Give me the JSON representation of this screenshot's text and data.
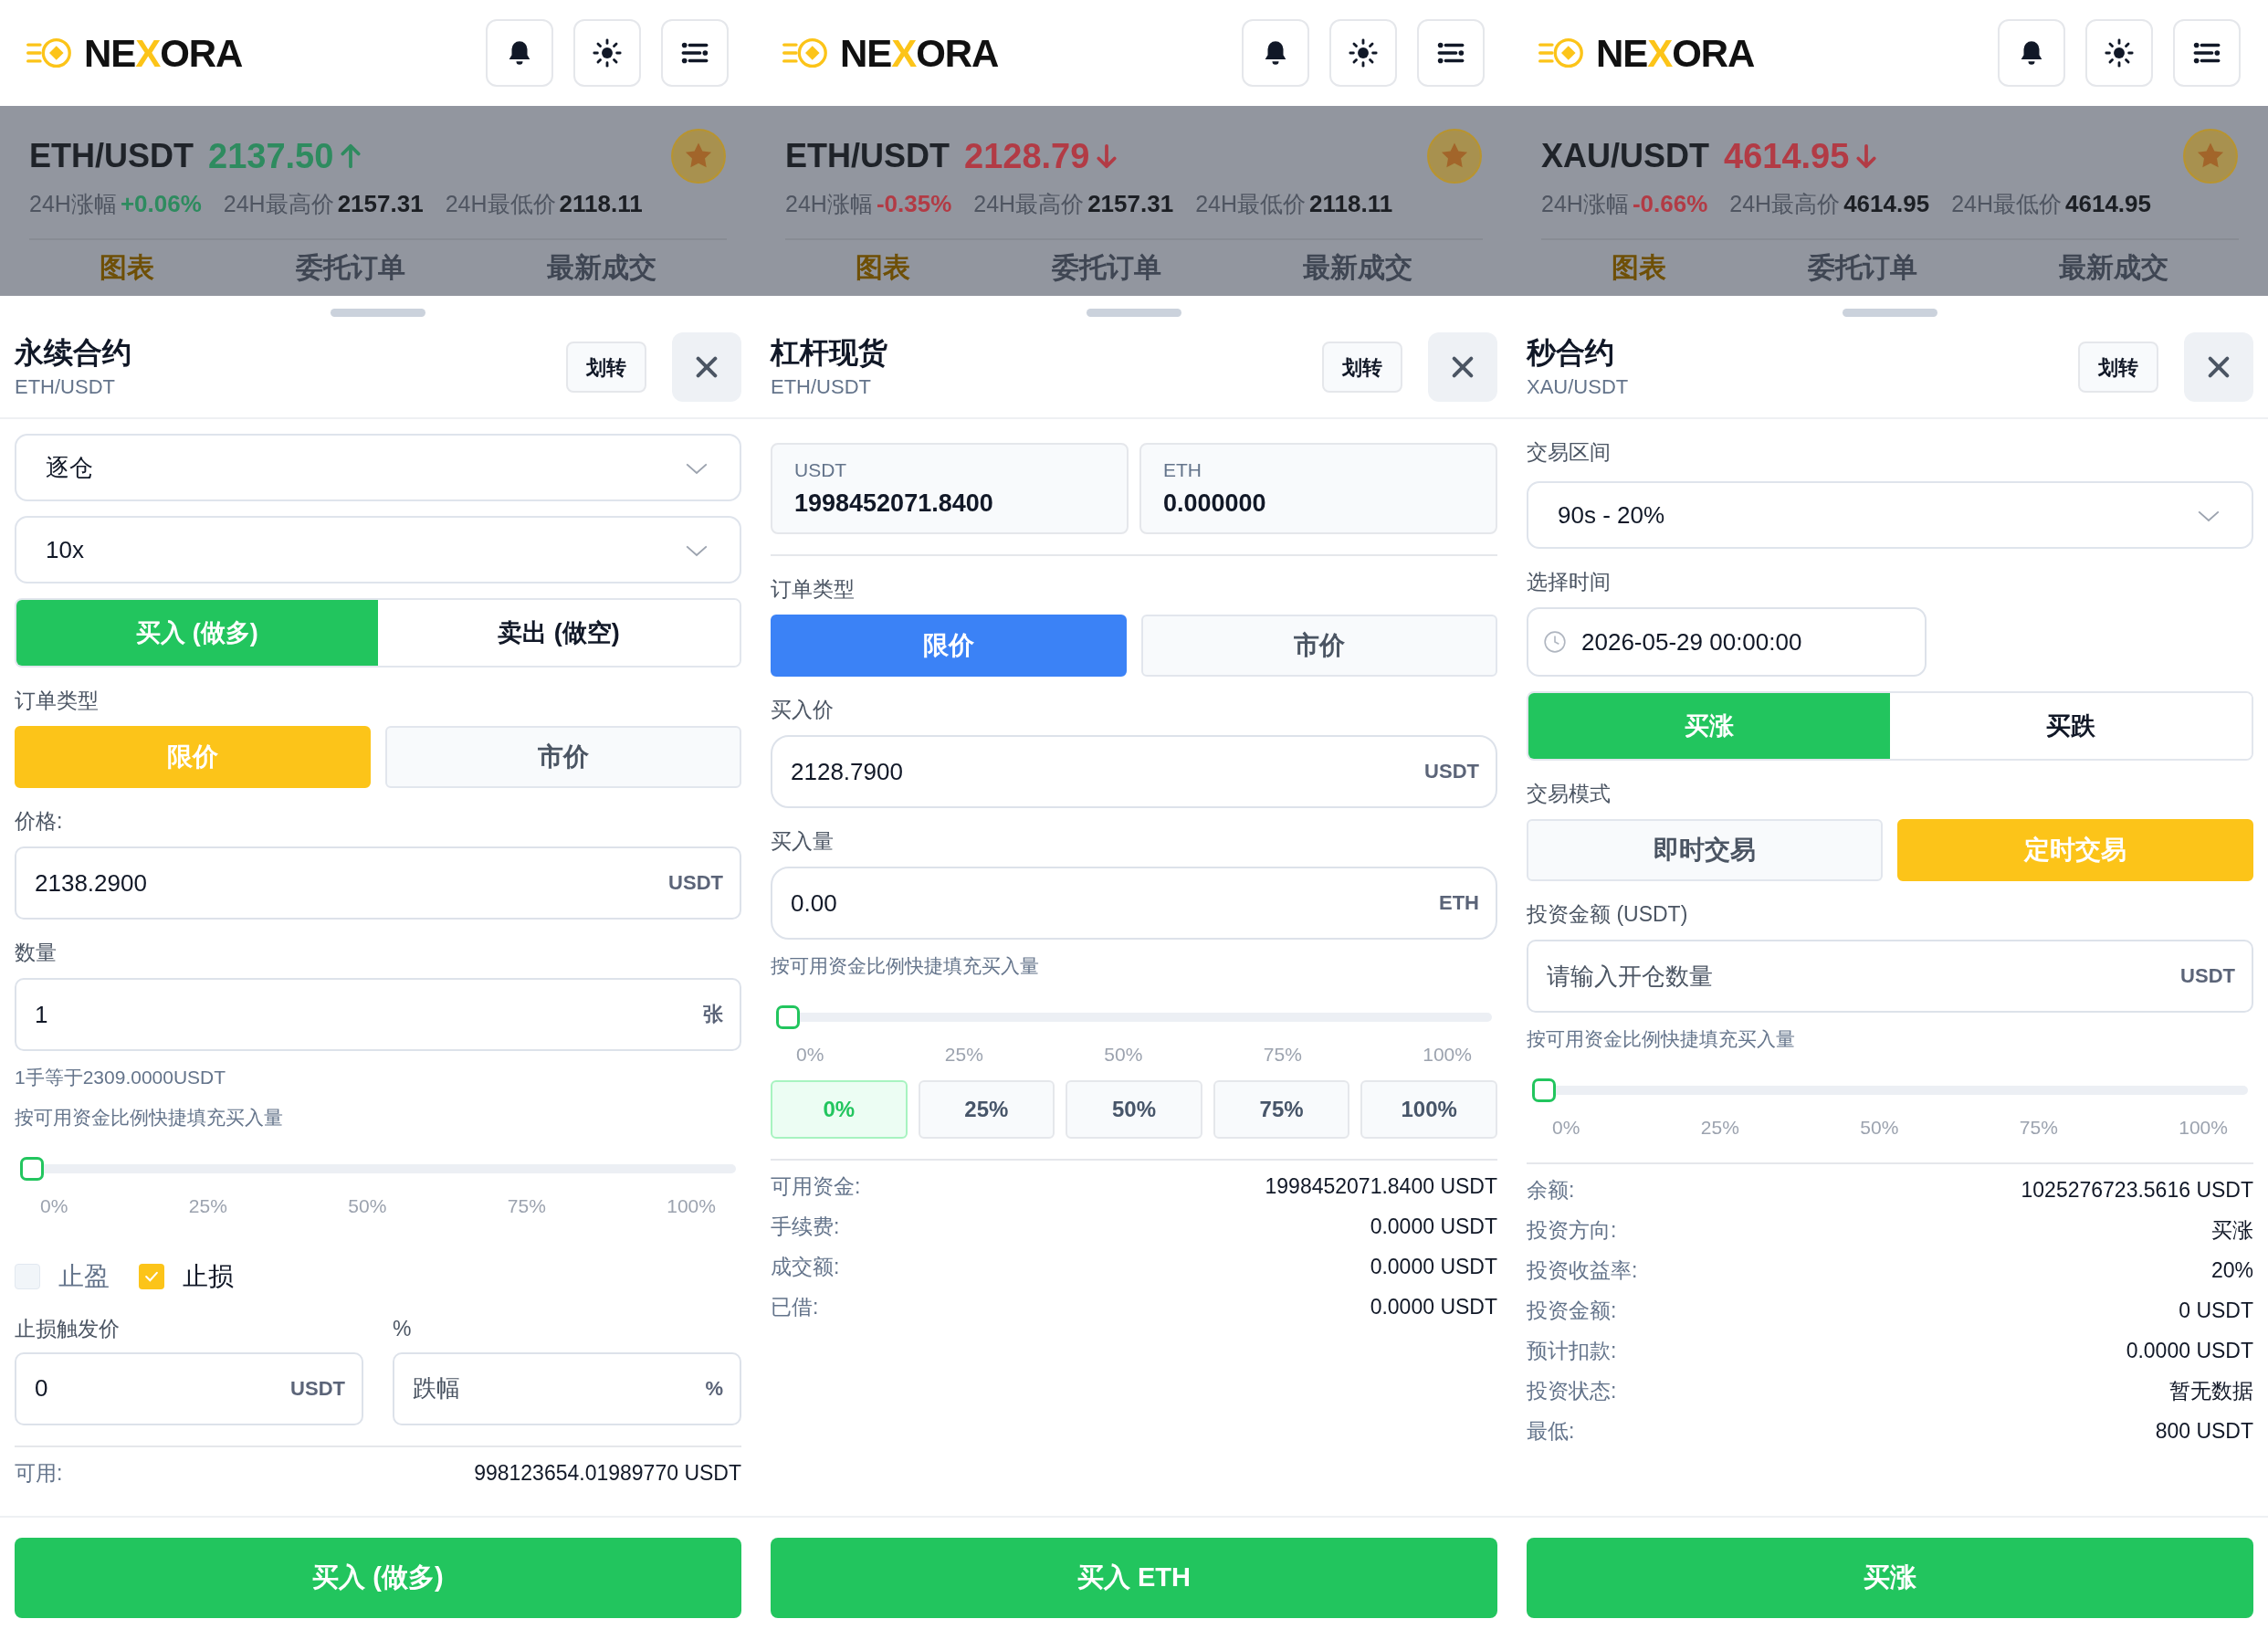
{
  "panels": [
    {
      "header": {
        "logo": [
          {
            "text": "NE",
            "accent": false
          },
          {
            "text": "X",
            "accent": true
          },
          {
            "text": "ORA",
            "accent": false
          }
        ]
      },
      "ticker": {
        "pair": "ETH/USDT",
        "price": "2137.50",
        "rising": true,
        "stats": [
          {
            "label": "24H涨幅",
            "value": "+0.06%",
            "kind": "change"
          },
          {
            "label": "24H最高价",
            "value": "2157.31",
            "kind": "plain"
          },
          {
            "label": "24H最低价",
            "value": "2118.11",
            "kind": "plain"
          }
        ],
        "tabs": [
          {
            "label": "图表",
            "selected": true
          },
          {
            "label": "委托订单",
            "selected": false
          },
          {
            "label": "最新成交",
            "selected": false
          }
        ]
      },
      "sheet": {
        "title": "永续合约",
        "subtitle": "ETH/USDT",
        "transfer": "划转",
        "blocks": [
          {
            "kind": "select",
            "value": "逐仓"
          },
          {
            "kind": "select",
            "value": "10x"
          },
          {
            "kind": "side_toggle",
            "options": [
              {
                "label": "买入 (做多)",
                "selected": true
              },
              {
                "label": "卖出 (做空)",
                "selected": false
              }
            ]
          },
          {
            "kind": "label",
            "text": "订单类型"
          },
          {
            "kind": "choice",
            "options": [
              {
                "label": "限价",
                "selected": true
              },
              {
                "label": "市价",
                "selected": false
              }
            ]
          },
          {
            "kind": "label",
            "text": "价格:"
          },
          {
            "kind": "input",
            "value": "2138.2900",
            "unit": "USDT"
          },
          {
            "kind": "label",
            "text": "数量"
          },
          {
            "kind": "input",
            "value": "1",
            "unit": "张"
          },
          {
            "kind": "note",
            "text": "1手等于2309.0000USDT"
          },
          {
            "kind": "note",
            "text": "按可用资金比例快捷填充买入量"
          },
          {
            "kind": "slider",
            "level": 0,
            "ticks": [
              "0%",
              "25%",
              "50%",
              "75%",
              "100%"
            ]
          },
          {
            "kind": "checks",
            "items": [
              {
                "label": "止盈",
                "checked": false
              },
              {
                "label": "止损",
                "checked": true
              }
            ]
          },
          {
            "kind": "pair_inputs",
            "fields": [
              {
                "label": "止损触发价",
                "value": "0",
                "unit": "USDT"
              },
              {
                "label": "%",
                "placeholder": "跌幅",
                "unit": "%"
              }
            ]
          },
          {
            "kind": "divider"
          },
          {
            "kind": "row",
            "label": "可用:",
            "value": "998123654.01989770 USDT"
          }
        ],
        "action": "买入 (做多)"
      }
    },
    {
      "header": {
        "logo": [
          {
            "text": "NE",
            "accent": false
          },
          {
            "text": "X",
            "accent": true
          },
          {
            "text": "ORA",
            "accent": false
          }
        ]
      },
      "ticker": {
        "pair": "ETH/USDT",
        "price": "2128.79",
        "rising": false,
        "stats": [
          {
            "label": "24H涨幅",
            "value": "-0.35%",
            "kind": "change"
          },
          {
            "label": "24H最高价",
            "value": "2157.31",
            "kind": "plain"
          },
          {
            "label": "24H最低价",
            "value": "2118.11",
            "kind": "plain"
          }
        ],
        "tabs": [
          {
            "label": "图表",
            "selected": true
          },
          {
            "label": "委托订单",
            "selected": false
          },
          {
            "label": "最新成交",
            "selected": false
          }
        ]
      },
      "sheet": {
        "title": "杠杆现货",
        "subtitle": "ETH/USDT",
        "transfer": "划转",
        "blocks": [
          {
            "kind": "balances",
            "cards": [
              {
                "currency": "USDT",
                "amount": "1998452071.8400"
              },
              {
                "currency": "ETH",
                "amount": "0.000000"
              }
            ]
          },
          {
            "kind": "divider"
          },
          {
            "kind": "label",
            "text": "订单类型"
          },
          {
            "kind": "segment",
            "options": [
              {
                "label": "限价",
                "selected": true
              },
              {
                "label": "市价",
                "selected": false
              }
            ]
          },
          {
            "kind": "label",
            "text": "买入价"
          },
          {
            "kind": "input",
            "value": "2128.7900",
            "unit": "USDT"
          },
          {
            "kind": "label",
            "text": "买入量"
          },
          {
            "kind": "input",
            "value": "0.00",
            "unit": "ETH"
          },
          {
            "kind": "note",
            "text": "按可用资金比例快捷填充买入量"
          },
          {
            "kind": "slider",
            "level": 0,
            "ticks": [
              "0%",
              "25%",
              "50%",
              "75%",
              "100%"
            ]
          },
          {
            "kind": "chips",
            "options": [
              {
                "label": "0%",
                "selected": true
              },
              {
                "label": "25%",
                "selected": false
              },
              {
                "label": "50%",
                "selected": false
              },
              {
                "label": "75%",
                "selected": false
              },
              {
                "label": "100%",
                "selected": false
              }
            ]
          },
          {
            "kind": "divider"
          },
          {
            "kind": "row",
            "label": "可用资金:",
            "value": "1998452071.8400 USDT"
          },
          {
            "kind": "row",
            "label": "手续费:",
            "value": "0.0000 USDT"
          },
          {
            "kind": "row",
            "label": "成交额:",
            "value": "0.0000 USDT"
          },
          {
            "kind": "row",
            "label": "已借:",
            "value": "0.0000 USDT"
          }
        ],
        "action": "买入 ETH"
      }
    },
    {
      "header": {
        "logo": [
          {
            "text": "NE",
            "accent": false
          },
          {
            "text": "X",
            "accent": true
          },
          {
            "text": "ORA",
            "accent": false
          }
        ]
      },
      "ticker": {
        "pair": "XAU/USDT",
        "price": "4614.95",
        "rising": false,
        "stats": [
          {
            "label": "24H涨幅",
            "value": "-0.66%",
            "kind": "change"
          },
          {
            "label": "24H最高价",
            "value": "4614.95",
            "kind": "plain"
          },
          {
            "label": "24H最低价",
            "value": "4614.95",
            "kind": "plain"
          }
        ],
        "tabs": [
          {
            "label": "图表",
            "selected": true
          },
          {
            "label": "委托订单",
            "selected": false
          },
          {
            "label": "最新成交",
            "selected": false
          }
        ]
      },
      "sheet": {
        "title": "秒合约",
        "subtitle": "XAU/USDT",
        "transfer": "划转",
        "blocks": [
          {
            "kind": "label",
            "text": "交易区间"
          },
          {
            "kind": "select",
            "value": "90s - 20%"
          },
          {
            "kind": "label",
            "text": "选择时间"
          },
          {
            "kind": "time_input",
            "value": "2026-05-29 00:00:00"
          },
          {
            "kind": "side_toggle",
            "options": [
              {
                "label": "买涨",
                "selected": true
              },
              {
                "label": "买跌",
                "selected": false
              }
            ]
          },
          {
            "kind": "label",
            "text": "交易模式"
          },
          {
            "kind": "choice",
            "options": [
              {
                "label": "即时交易",
                "selected": false
              },
              {
                "label": "定时交易",
                "selected": true
              }
            ]
          },
          {
            "kind": "label",
            "text": "投资金额 (USDT)"
          },
          {
            "kind": "input",
            "placeholder": "请输入开仓数量",
            "unit": "USDT"
          },
          {
            "kind": "note",
            "text": "按可用资金比例快捷填充买入量"
          },
          {
            "kind": "slider",
            "level": 0,
            "ticks": [
              "0%",
              "25%",
              "50%",
              "75%",
              "100%"
            ]
          },
          {
            "kind": "divider"
          },
          {
            "kind": "row",
            "label": "余额:",
            "value": "1025276723.5616 USDT"
          },
          {
            "kind": "row",
            "label": "投资方向:",
            "value": "买涨"
          },
          {
            "kind": "row",
            "label": "投资收益率:",
            "value": "20%"
          },
          {
            "kind": "row",
            "label": "投资金额:",
            "value": "0 USDT"
          },
          {
            "kind": "row",
            "label": "预计扣款:",
            "value": "0.0000 USDT"
          },
          {
            "kind": "row",
            "label": "投资状态:",
            "value": "暂无数据"
          },
          {
            "kind": "row",
            "label": "最低:",
            "value": "800 USDT"
          }
        ],
        "action": "买涨"
      }
    }
  ]
}
